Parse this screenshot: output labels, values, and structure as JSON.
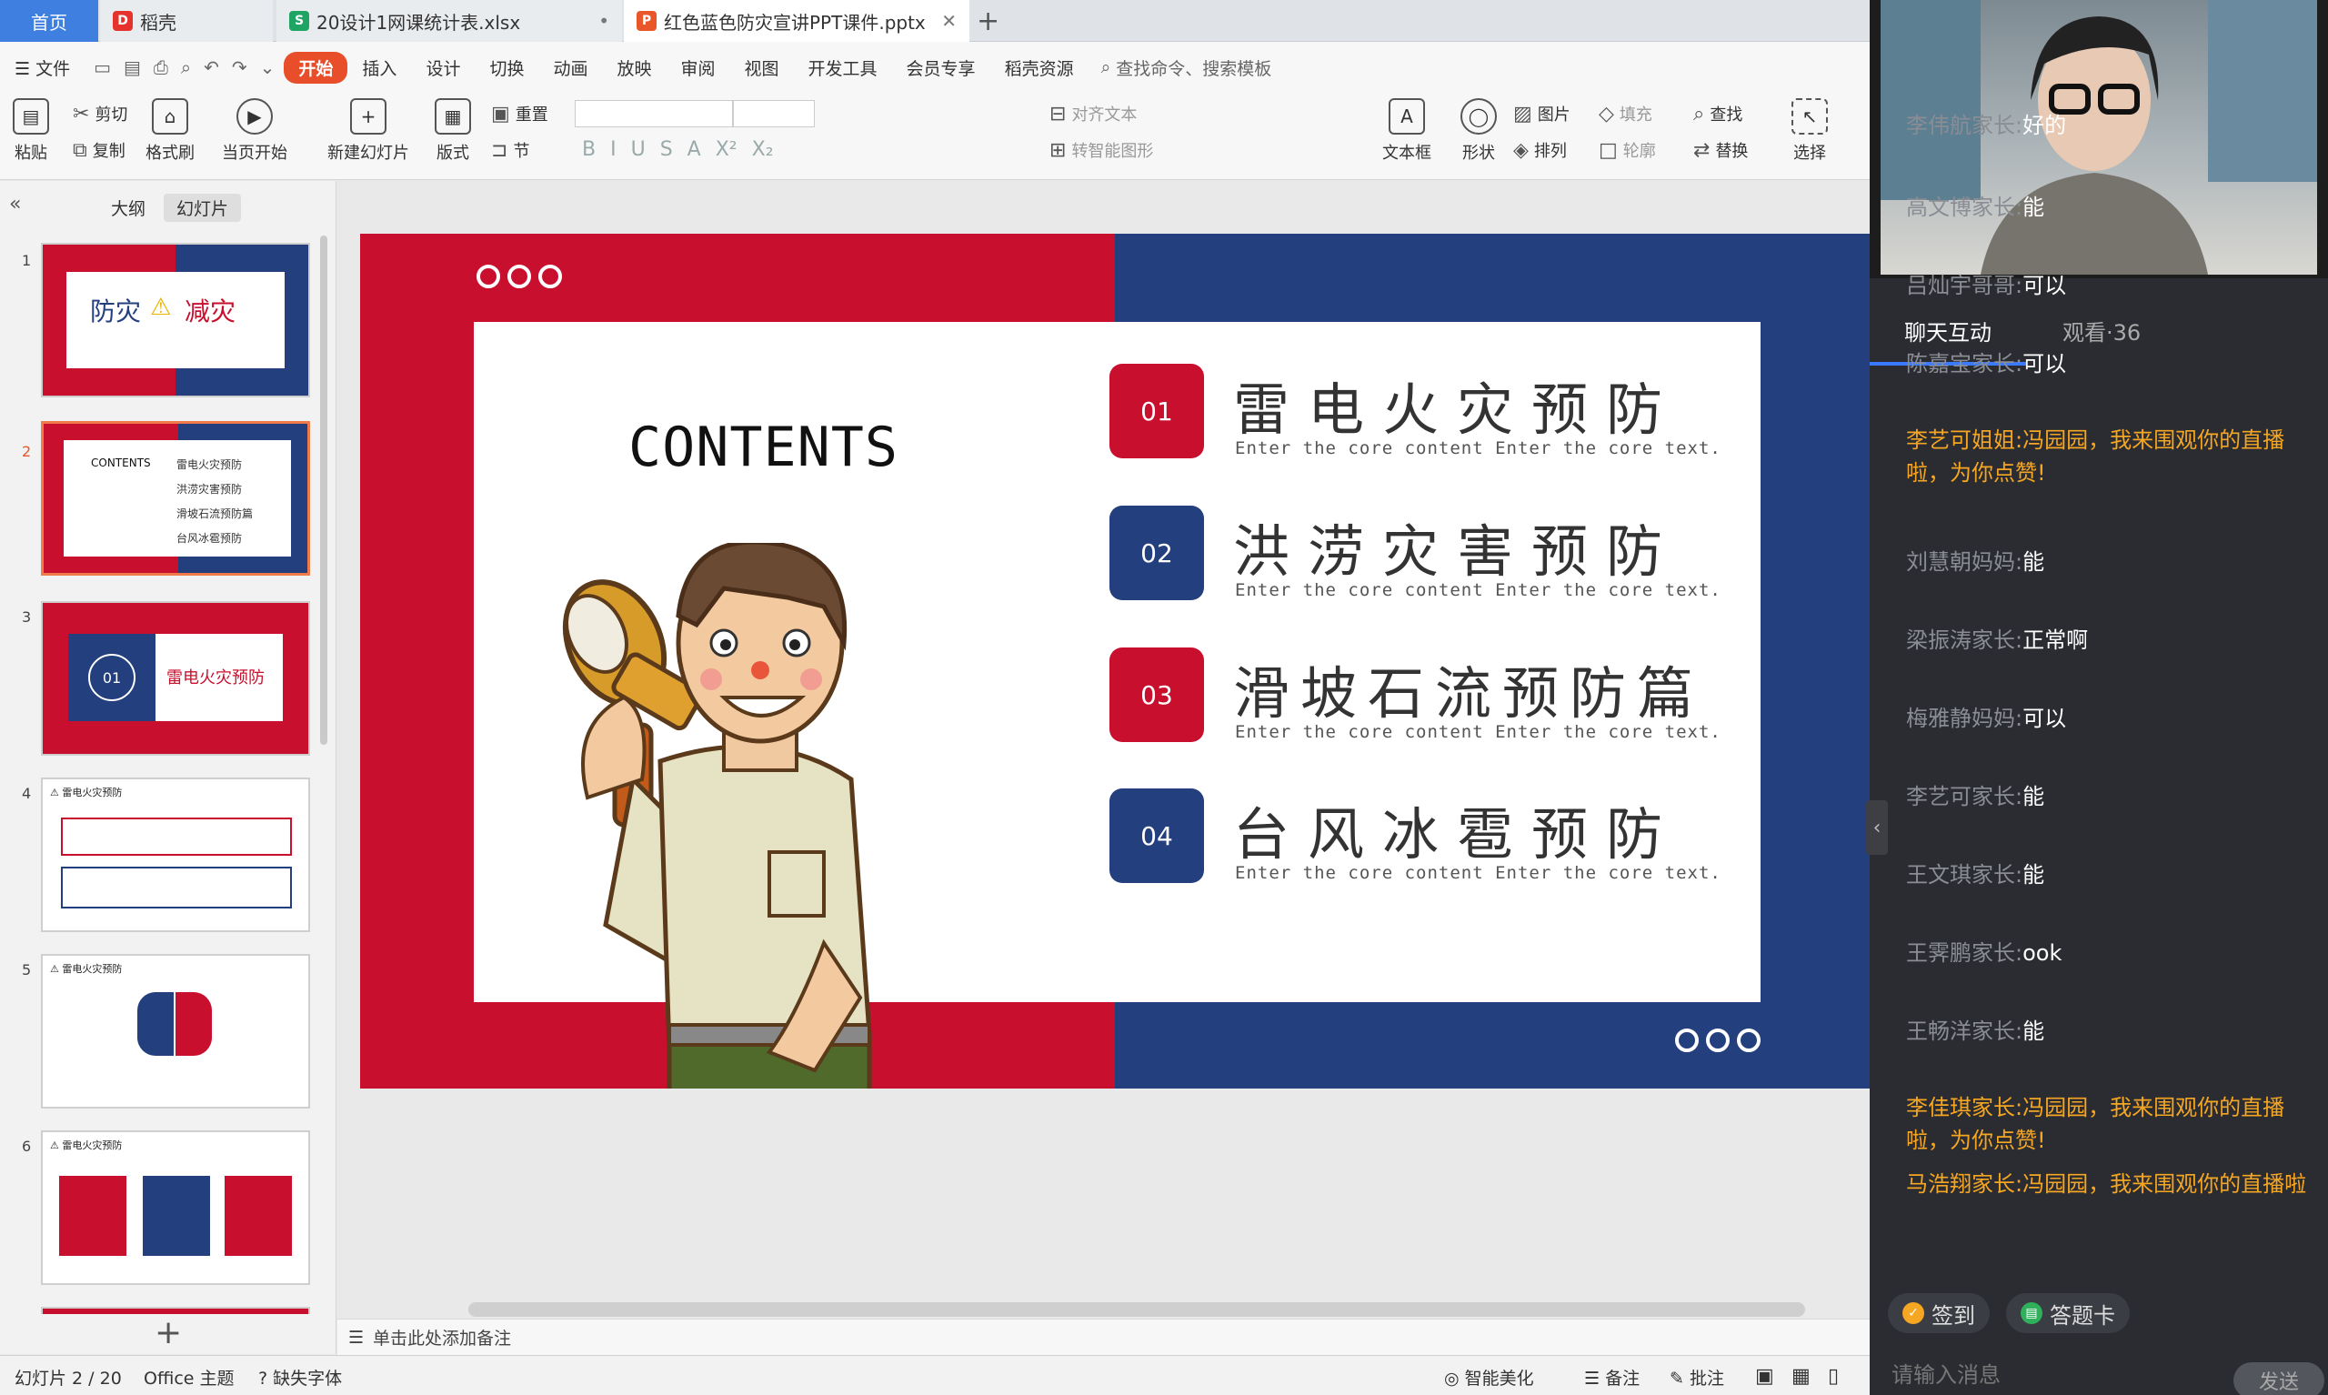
{
  "tabs": {
    "home": "首页",
    "t1": "稻壳",
    "t2": "20设计1网课统计表.xlsx",
    "t3": "红色蓝色防灾宣讲PPT课件.pptx"
  },
  "menu": {
    "file": "文件",
    "items": [
      "开始",
      "插入",
      "设计",
      "切换",
      "动画",
      "放映",
      "审阅",
      "视图",
      "开发工具",
      "会员专享",
      "稻壳资源"
    ],
    "search": "查找命令、搜索模板"
  },
  "ribbon": {
    "paste": "粘贴",
    "cut": "剪切",
    "copy": "复制",
    "painter": "格式刷",
    "start_here": "当页开始",
    "new_slide": "新建幻灯片",
    "layout": "版式",
    "reset": "重置",
    "section": "节",
    "align_text": "对齐文本",
    "smart_shape": "转智能图形",
    "textbox": "文本框",
    "shape": "形状",
    "picture": "图片",
    "arrange": "排列",
    "fill": "填充",
    "outline": "轮廓",
    "find": "查找",
    "replace": "替换",
    "select": "选择"
  },
  "panel": {
    "outline": "大纲",
    "slides": "幻灯片"
  },
  "slide": {
    "contents": "CONTENTS",
    "items": [
      {
        "num": "01",
        "title": "雷电火灾预防",
        "sub": "Enter the core content Enter the core text.",
        "color": "#c8102e"
      },
      {
        "num": "02",
        "title": "洪涝灾害预防",
        "sub": "Enter the core content Enter the core text.",
        "color": "#233f7d"
      },
      {
        "num": "03",
        "title": "滑坡石流预防篇",
        "sub": "Enter the core content Enter the core text.",
        "color": "#c8102e"
      },
      {
        "num": "04",
        "title": "台风冰雹预防",
        "sub": "Enter the core content Enter the core text.",
        "color": "#233f7d"
      }
    ]
  },
  "thumbs": {
    "t1": {
      "a": "防灾",
      "b": "减灾"
    },
    "t2": {
      "c": "CONTENTS",
      "items": [
        "雷电火灾预防",
        "洪涝灾害预防",
        "滑坡石流预防篇",
        "台风冰雹预防"
      ]
    },
    "t3": {
      "num": "01",
      "title": "雷电火灾预防"
    },
    "t4": {
      "h": "雷电火灾预防"
    },
    "t5": {
      "h": "雷电火灾预防"
    },
    "t6": {
      "h": "雷电火灾预防"
    }
  },
  "notes": "单击此处添加备注",
  "status": {
    "slide": "幻灯片 2 / 20",
    "theme": "Office 主题",
    "font": "缺失字体",
    "beautify": "智能美化",
    "note": "备注",
    "comment": "批注"
  },
  "chat": {
    "tab1": "聊天互动",
    "tab2": "观看·36",
    "messages": [
      {
        "name": "李伟航家长:",
        "text": "好的",
        "hl": false
      },
      {
        "name": "高文博家长:",
        "text": "能",
        "hl": false
      },
      {
        "name": "吕灿宇哥哥:",
        "text": "可以",
        "hl": false
      },
      {
        "name": "陈嘉宝家长:",
        "text": "可以",
        "hl": false
      },
      {
        "name": "李艺可姐姐:",
        "text": "冯园园，我来围观你的直播啦，为你点赞!",
        "hl": true
      },
      {
        "name": "刘慧朝妈妈:",
        "text": "能",
        "hl": false
      },
      {
        "name": "梁振涛家长:",
        "text": "正常啊",
        "hl": false
      },
      {
        "name": "梅雅静妈妈:",
        "text": "可以",
        "hl": false
      },
      {
        "name": "李艺可家长:",
        "text": "能",
        "hl": false
      },
      {
        "name": "王文琪家长:",
        "text": "能",
        "hl": false
      },
      {
        "name": "王霁鹏家长:",
        "text": "ook",
        "hl": false
      },
      {
        "name": "王畅洋家长:",
        "text": "能",
        "hl": false
      },
      {
        "name": "李佳琪家长:",
        "text": "冯园园，我来围观你的直播啦，为你点赞!",
        "hl": true
      },
      {
        "name": "马浩翔家长:",
        "text": "冯园园，我来围观你的直播啦",
        "hl": true
      }
    ],
    "checkin": "签到",
    "answer": "答题卡",
    "input": "请输入消息",
    "send": "发送"
  }
}
